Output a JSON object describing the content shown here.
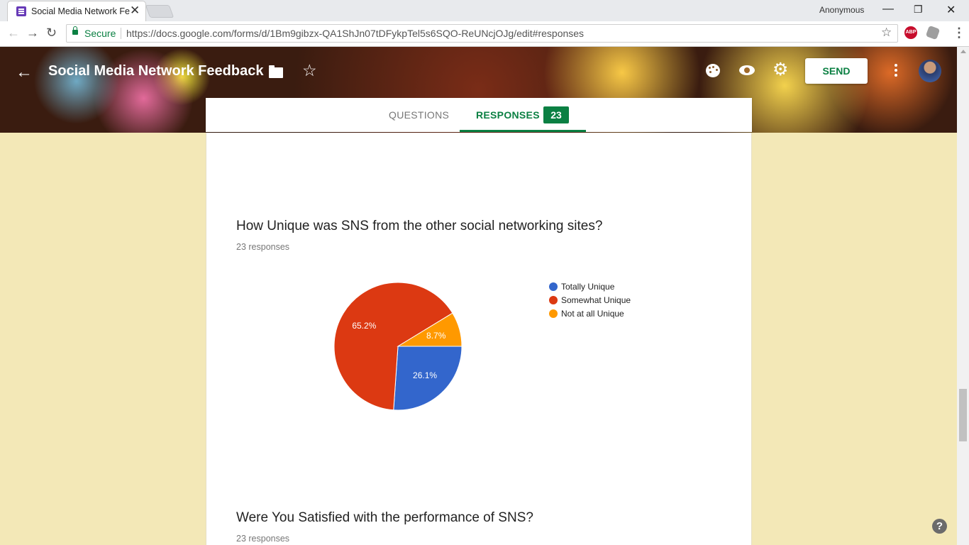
{
  "browser": {
    "tab_title": "Social Media Network Fe",
    "profile_name": "Anonymous",
    "secure_label": "Secure",
    "url": "https://docs.google.com/forms/d/1Bm9gibzx-QA1ShJn07tDFykpTel5s6SQO-ReUNcjOJg/edit#responses",
    "extension_label": "ABP"
  },
  "header": {
    "form_title": "Social Media Network Feedback",
    "send_label": "SEND"
  },
  "tabs": {
    "questions_label": "QUESTIONS",
    "responses_label": "RESPONSES",
    "responses_count": "23"
  },
  "questions": [
    {
      "title": "How Unique was SNS from the other social networking sites?",
      "responses_text": "23 responses"
    },
    {
      "title": "Were You Satisfied with the performance of SNS?",
      "responses_text": "23 responses"
    }
  ],
  "colors": {
    "accent": "#0b8043",
    "page_background": "#f3e8b7"
  },
  "chart_data": {
    "type": "pie",
    "slices": [
      {
        "label": "Totally Unique",
        "value": 26.1,
        "color": "#3366cc",
        "data_label": "26.1%"
      },
      {
        "label": "Somewhat Unique",
        "value": 65.2,
        "color": "#dc3912",
        "data_label": "65.2%"
      },
      {
        "label": "Not at all Unique",
        "value": 8.7,
        "color": "#ff9900",
        "data_label": "8.7%"
      }
    ],
    "legend_position": "right"
  }
}
